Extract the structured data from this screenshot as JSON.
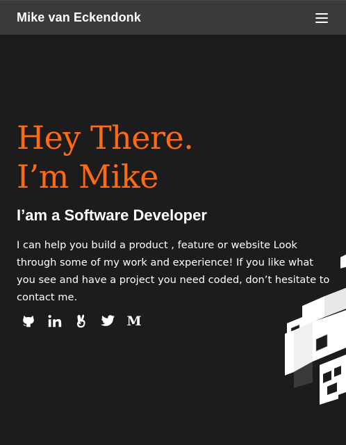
{
  "nav": {
    "brand": "Mike van Eckendonk",
    "menu_icon": "hamburger-menu-icon"
  },
  "hero": {
    "headline_line1": "Hey There.",
    "headline_line2": "I’m Mike",
    "subheading": "I’am a Software Developer",
    "intro": "I can help you build a product , feature or website Look through some of my work and experience! If you like what you see and have a project you need coded, don’t hesitate to contact me."
  },
  "socials": [
    {
      "icon": "github-icon"
    },
    {
      "icon": "linkedin-icon"
    },
    {
      "icon": "angellist-icon"
    },
    {
      "icon": "twitter-icon"
    },
    {
      "icon": "medium-icon",
      "glyph": "M"
    }
  ],
  "colors": {
    "background": "#1d1c1c",
    "navbar": "#3b3a39",
    "accent": "#ff6a13",
    "text": "#ffffff"
  }
}
